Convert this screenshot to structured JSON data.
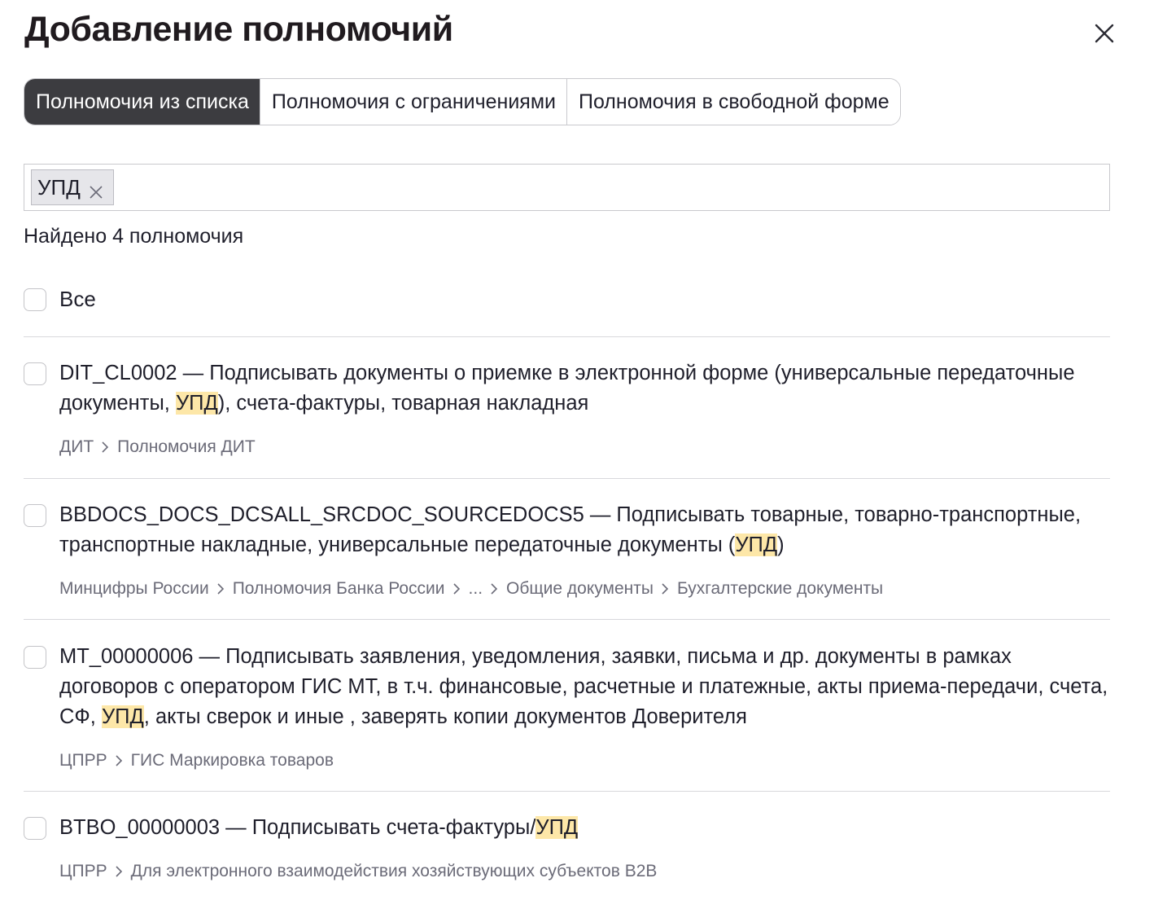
{
  "dialog": {
    "title": "Добавление полномочий"
  },
  "tabs": [
    {
      "label": "Полномочия из списка",
      "active": true
    },
    {
      "label": "Полномочия с ограничениями",
      "active": false
    },
    {
      "label": "Полномочия в свободной форме",
      "active": false
    }
  ],
  "search": {
    "chip_label": "УПД"
  },
  "results": {
    "found_text": "Найдено 4 полномочия",
    "select_all_label": "Все",
    "items": [
      {
        "text_before": "DIT_CL0002 — Подписывать документы о приемке в электронной форме (универсальные передаточные документы, ",
        "highlight": "УПД",
        "text_after": "), счета-фактуры, товарная накладная",
        "path": [
          "ДИТ",
          "Полномочия ДИТ"
        ]
      },
      {
        "text_before": "BBDOCS_DOCS_DCSALL_SRCDOC_SOURCEDOCS5 — Подписывать товарные, товарно-транспортные, транспортные накладные, универсальные передаточные документы (",
        "highlight": "УПД",
        "text_after": ")",
        "path": [
          "Минцифры России",
          "Полномочия Банка России",
          "...",
          "Общие документы",
          "Бухгалтерские документы"
        ]
      },
      {
        "text_before": "MT_00000006 — Подписывать заявления, уведомления, заявки, письма и др. документы в рамках договоров с оператором ГИС МТ, в т.ч. финансовые, расчетные и платежные, акты приема-передачи, счета, СФ, ",
        "highlight": "УПД",
        "text_after": ", акты сверок и иные , заверять копии документов Доверителя",
        "path": [
          "ЦПРР",
          "ГИС Маркировка товаров"
        ]
      },
      {
        "text_before": "BTBO_00000003 — Подписывать счета-фактуры/",
        "highlight": "УПД",
        "text_after": "",
        "path": [
          "ЦПРР",
          "Для электронного взаимодействия хозяйствующих субъектов B2B"
        ]
      }
    ]
  },
  "colors": {
    "active_tab_bg": "#3c3c40",
    "highlight_bg": "#fde7a8",
    "border": "#c9c9cd",
    "path_text": "#6b6b78"
  }
}
